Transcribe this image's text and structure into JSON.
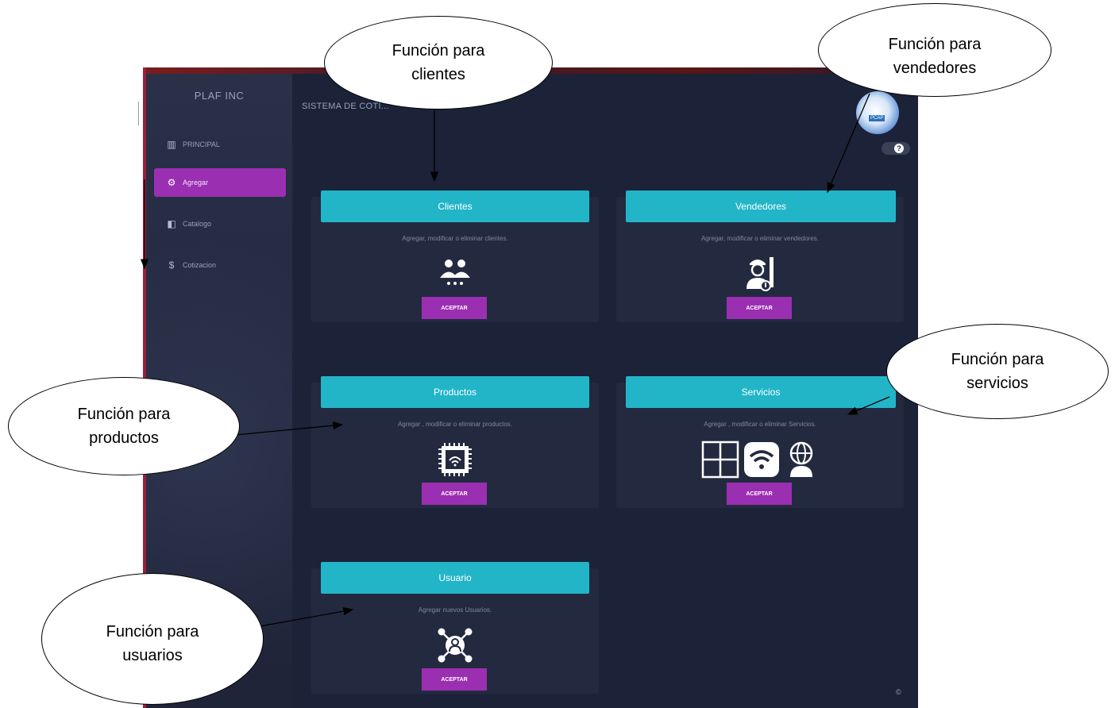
{
  "app": {
    "brand": "PLAF INC",
    "page_title": "SISTEMA DE COTI..."
  },
  "sidebar": {
    "items": [
      {
        "label": "PRINCIPAL",
        "icon": "grid-icon",
        "glyph": "▥",
        "active": false
      },
      {
        "label": "Agregar",
        "icon": "gear-icon",
        "glyph": "⚙",
        "active": true
      },
      {
        "label": "Catalogo",
        "icon": "book-icon",
        "glyph": "◧",
        "active": false
      },
      {
        "label": "Cotizacion",
        "icon": "dollar-icon",
        "glyph": "$",
        "active": false
      }
    ]
  },
  "cards": {
    "clientes": {
      "title": "Clientes",
      "desc": "Agregar, modificar o eliminar clientes.",
      "button": "ACEPTAR",
      "icon": "users-icon"
    },
    "vendedores": {
      "title": "Vendedores",
      "desc": "Agregar, modificar o eliminar vendedores.",
      "button": "ACEPTAR",
      "icon": "seller-icon"
    },
    "productos": {
      "title": "Productos",
      "desc": "Agregar , modificar o eliminar productos.",
      "button": "ACEPTAR",
      "icon": "chip-icon"
    },
    "servicios": {
      "title": "Servicios",
      "desc": "Agregar , modificar o eliminar Servicios.",
      "button": "ACEPTAR",
      "icon": "services-icon"
    },
    "usuario": {
      "title": "Usuario",
      "desc": "Agregar nuevos Usuarios.",
      "button": "ACEPTAR",
      "icon": "user-network-icon"
    }
  },
  "topright": {
    "avatar_label": "PCAP",
    "help_glyph": "?",
    "footer_glyph": "©"
  },
  "annotations": {
    "clientes": "Función para\nclientes",
    "vendedores": "Función para\nvendedores",
    "servicios": "Función para\nservicios",
    "productos": "Función para\nproductos",
    "usuarios": "Función para\nusuarios"
  },
  "colors": {
    "background": "#1c2238",
    "card": "#232a40",
    "header": "#22b5c8",
    "accent": "#9b2fb1"
  }
}
